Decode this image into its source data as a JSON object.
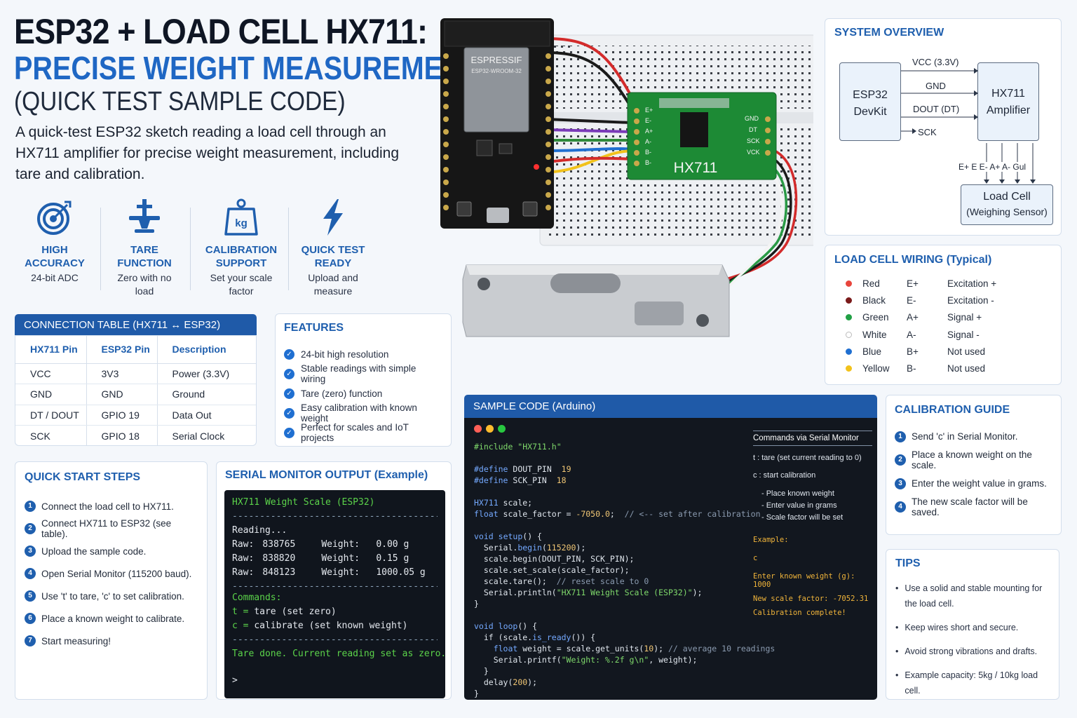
{
  "header": {
    "title_line1": "ESP32 + LOAD CELL HX711:",
    "title_line2": "PRECISE WEIGHT MEASUREMENT",
    "title_line3": "(QUICK TEST SAMPLE CODE)",
    "intro": "A quick-test ESP32 sketch reading a load cell through an HX711 amplifier for precise weight measurement, including tare and calibration."
  },
  "feature_icons": [
    {
      "title": "HIGH ACCURACY",
      "sub": "24-bit ADC",
      "icon": "target-icon"
    },
    {
      "title": "TARE FUNCTION",
      "sub": "Zero with no load",
      "icon": "tare-scale-icon"
    },
    {
      "title": "CALIBRATION SUPPORT",
      "sub": "Set your scale factor",
      "icon": "kg-weight-icon"
    },
    {
      "title": "QUICK TEST READY",
      "sub": "Upload and measure",
      "icon": "lightning-icon"
    }
  ],
  "photo": {
    "module_brand": "ESPRESSIF",
    "module_model": "ESP32-WROOM-32",
    "hx711_label": "HX711",
    "pins_left": [
      "E+",
      "E-",
      "A+",
      "A-",
      "B-",
      "B-"
    ],
    "pins_right": [
      "GND",
      "DT",
      "SCK",
      "VCK"
    ]
  },
  "connection_table": {
    "title": "CONNECTION TABLE (HX711 ↔ ESP32)",
    "headers": [
      "HX711 Pin",
      "ESP32 Pin",
      "Description"
    ],
    "rows": [
      [
        "VCC",
        "3V3",
        "Power (3.3V)"
      ],
      [
        "GND",
        "GND",
        "Ground"
      ],
      [
        "DT / DOUT",
        "GPIO 19",
        "Data Out"
      ],
      [
        "SCK",
        "GPIO 18",
        "Serial Clock"
      ]
    ]
  },
  "features": {
    "title": "FEATURES",
    "items": [
      "24-bit high resolution",
      "Stable readings with simple wiring",
      "Tare (zero) function",
      "Easy calibration with known weight",
      "Perfect for scales and IoT projects"
    ]
  },
  "quick_start": {
    "title": "QUICK START STEPS",
    "steps": [
      "Connect the load cell to HX711.",
      "Connect HX711 to ESP32 (see table).",
      "Upload the sample code.",
      "Open Serial Monitor (115200 baud).",
      "Use 't' to tare, 'c' to set calibration.",
      "Place a known weight to calibrate.",
      "Start measuring!"
    ]
  },
  "serial_monitor": {
    "title": "SERIAL MONITOR OUTPUT (Example)",
    "banner": "HX711 Weight Scale (ESP32)",
    "dashes": "----------------------------------------",
    "reading": "Reading...",
    "rows": [
      {
        "raw_label": "Raw:",
        "raw": "838765",
        "w_label": "Weight:",
        "w": "0.00 g"
      },
      {
        "raw_label": "Raw:",
        "raw": "838820",
        "w_label": "Weight:",
        "w": "0.15 g"
      },
      {
        "raw_label": "Raw:",
        "raw": "848123",
        "w_label": "Weight:",
        "w": "1000.05 g"
      }
    ],
    "commands_label": "Commands:",
    "cmd_t": "tare (set zero)",
    "cmd_c": "calibrate (set known weight)",
    "tare_done": "Tare done. Current reading set as zero.",
    "prompt": ">"
  },
  "code": {
    "title": "SAMPLE CODE (Arduino)",
    "commands_header": "Commands via Serial Monitor",
    "cmd_t": "t : tare (set current reading to 0)",
    "cmd_c": "c : start calibration",
    "cmd_steps": [
      "- Place known weight",
      "- Enter value in grams",
      "- Scale factor will be set"
    ],
    "example_label": "Example:",
    "example_c": "c",
    "example_out": [
      "Enter known weight (g): 1000",
      "New scale factor: -7052.31",
      "Calibration complete!"
    ]
  },
  "system_overview": {
    "title": "SYSTEM OVERVIEW",
    "esp_label": "ESP32\nDevKit",
    "hx_label": "HX711\nAmplifier",
    "signals": [
      "VCC (3.3V)",
      "GND",
      "DOUT (DT)",
      "SCK"
    ],
    "hx_pins": "E+ E E- A+ A- Gul",
    "load_cell": "Load Cell",
    "load_cell_sub": "(Weighing Sensor)"
  },
  "wiring": {
    "title": "LOAD CELL WIRING (Typical)",
    "rows": [
      {
        "color_name": "Red",
        "pin": "E+",
        "desc": "Excitation +",
        "color": "#e8453c"
      },
      {
        "color_name": "Black",
        "pin": "E-",
        "desc": "Excitation -",
        "color": "#7a1a1a"
      },
      {
        "color_name": "Green",
        "pin": "A+",
        "desc": "Signal +",
        "color": "#21a045"
      },
      {
        "color_name": "White",
        "pin": "A-",
        "desc": "Signal -",
        "color": "#ffffff"
      },
      {
        "color_name": "Blue",
        "pin": "B+",
        "desc": "Not used",
        "color": "#1f6fd1"
      },
      {
        "color_name": "Yellow",
        "pin": "B-",
        "desc": "Not used",
        "color": "#f2c21b"
      }
    ]
  },
  "calibration": {
    "title": "CALIBRATION GUIDE",
    "steps": [
      "Send 'c' in Serial Monitor.",
      "Place a known weight on the scale.",
      "Enter the weight value in grams.",
      "The new scale factor will be saved."
    ]
  },
  "tips": {
    "title": "TIPS",
    "items": [
      "Use a solid and stable mounting for the load cell.",
      "Keep wires short and secure.",
      "Avoid strong vibrations and drafts.",
      "Example capacity: 5kg / 10kg load cell."
    ]
  },
  "colors": {
    "accent": "#1f5fae",
    "header_bar": "#1f5aa8",
    "terminal_bg": "#10151d",
    "terminal_green": "#5bd34a"
  }
}
